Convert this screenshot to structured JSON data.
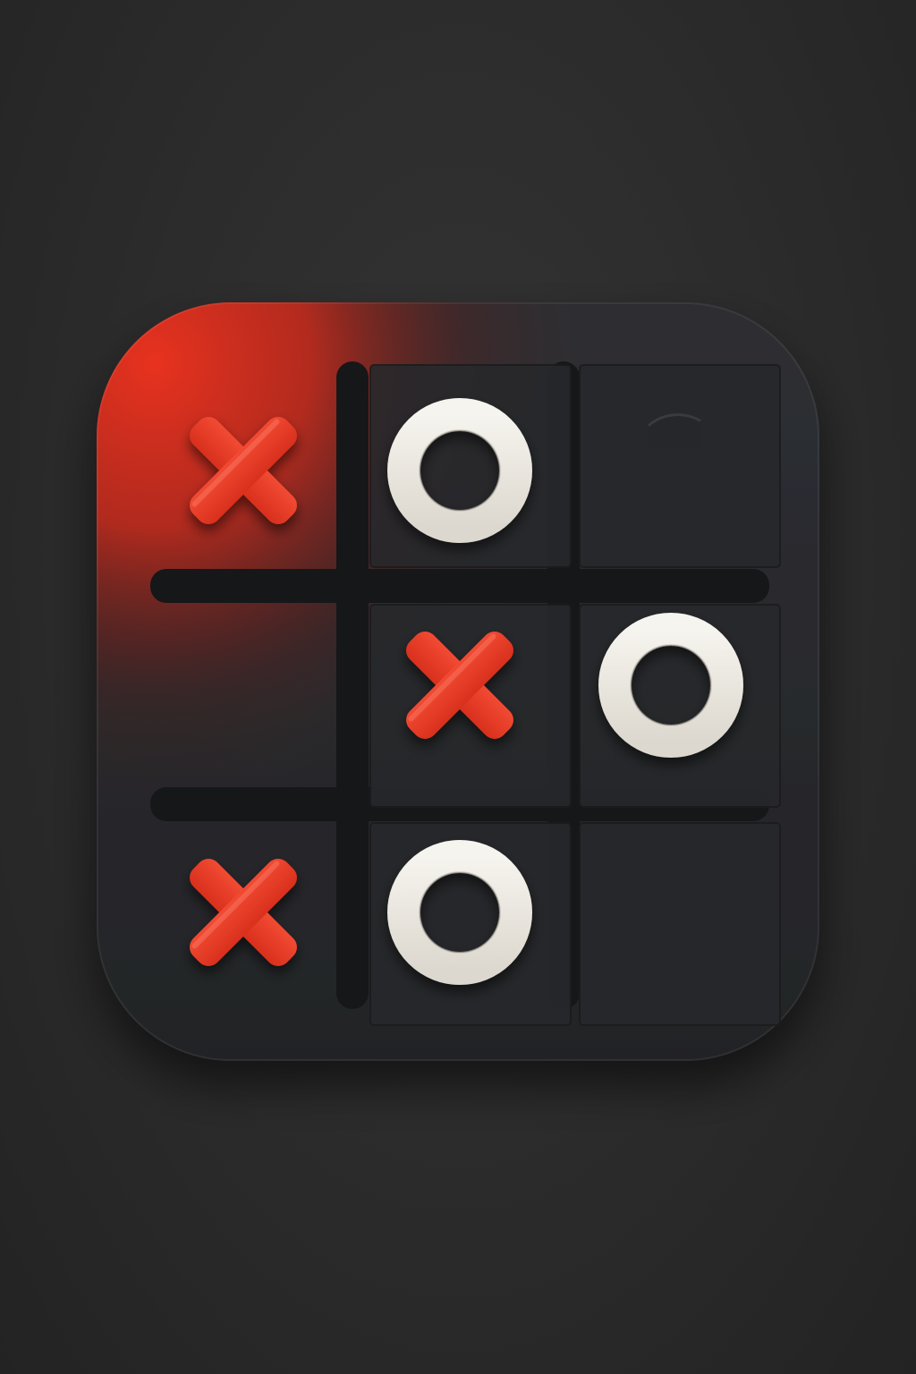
{
  "board": {
    "rows": 3,
    "cols": 3,
    "cells": [
      [
        "X",
        "O",
        ""
      ],
      [
        "",
        "X",
        "O"
      ],
      [
        "X",
        "O",
        ""
      ]
    ]
  },
  "icons": {
    "x_mark": "x-mark-icon",
    "o_mark": "o-mark-icon"
  },
  "colors": {
    "background": "#2b2b2b",
    "tile": "#2a2b2e",
    "accent_red": "#e8321f",
    "piece_white": "#ece9e2",
    "groove": "#161719"
  }
}
